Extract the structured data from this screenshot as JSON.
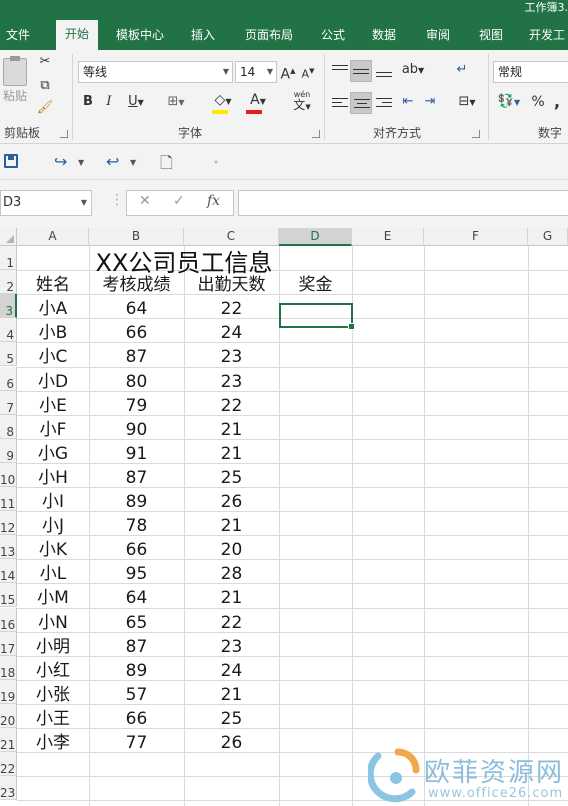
{
  "app": {
    "title": "工作簿3."
  },
  "tabs": [
    {
      "label": "文件",
      "active": false
    },
    {
      "label": "开始",
      "active": true
    },
    {
      "label": "模板中心",
      "active": false
    },
    {
      "label": "插入",
      "active": false
    },
    {
      "label": "页面布局",
      "active": false
    },
    {
      "label": "公式",
      "active": false
    },
    {
      "label": "数据",
      "active": false
    },
    {
      "label": "审阅",
      "active": false
    },
    {
      "label": "视图",
      "active": false
    },
    {
      "label": "开发工",
      "active": false
    }
  ],
  "ribbon": {
    "clipboard": {
      "label": "剪贴板",
      "paste": "粘贴"
    },
    "font": {
      "label": "字体",
      "name": "等线",
      "size": "14",
      "bold": "B",
      "italic": "I",
      "underline": "U",
      "grow": "A",
      "shrink": "A",
      "font_color": "A",
      "phonetic_top": "wén",
      "phonetic_bottom": "文"
    },
    "alignment": {
      "label": "对齐方式"
    },
    "number": {
      "label": "数字",
      "format": "常规",
      "percent": "%",
      "comma": ","
    }
  },
  "formula_bar": {
    "cell_ref": "D3",
    "cancel": "✕",
    "confirm": "✓",
    "fx": "fx",
    "value": ""
  },
  "sheet": {
    "columns": [
      "A",
      "B",
      "C",
      "D",
      "E",
      "F",
      "G"
    ],
    "active_column": "D",
    "rows": [
      "1",
      "2",
      "3",
      "4",
      "5",
      "6",
      "7",
      "8",
      "9",
      "10",
      "11",
      "12",
      "13",
      "14",
      "15",
      "16",
      "17",
      "18",
      "19",
      "20",
      "21",
      "22",
      "23"
    ],
    "active_row": "3",
    "title": "XX公司员工信息",
    "headers": [
      "姓名",
      "考核成绩",
      "出勤天数",
      "奖金"
    ],
    "records": [
      [
        "小A",
        "64",
        "22"
      ],
      [
        "小B",
        "66",
        "24"
      ],
      [
        "小C",
        "87",
        "23"
      ],
      [
        "小D",
        "80",
        "23"
      ],
      [
        "小E",
        "79",
        "22"
      ],
      [
        "小F",
        "90",
        "21"
      ],
      [
        "小G",
        "91",
        "21"
      ],
      [
        "小H",
        "87",
        "25"
      ],
      [
        "小I",
        "89",
        "26"
      ],
      [
        "小J",
        "78",
        "21"
      ],
      [
        "小K",
        "66",
        "20"
      ],
      [
        "小L",
        "95",
        "28"
      ],
      [
        "小M",
        "64",
        "21"
      ],
      [
        "小N",
        "65",
        "22"
      ],
      [
        "小明",
        "87",
        "23"
      ],
      [
        "小红",
        "89",
        "24"
      ],
      [
        "小张",
        "57",
        "21"
      ],
      [
        "小王",
        "66",
        "25"
      ],
      [
        "小李",
        "77",
        "26"
      ]
    ]
  },
  "watermark": {
    "text": "欧菲资源网",
    "url": "www.office26.com"
  },
  "colors": {
    "brand": "#217346",
    "ribbon_bg": "#f3f3f3",
    "font_color_bar": "#e02020",
    "fill_color_bar": "#ffe500"
  }
}
